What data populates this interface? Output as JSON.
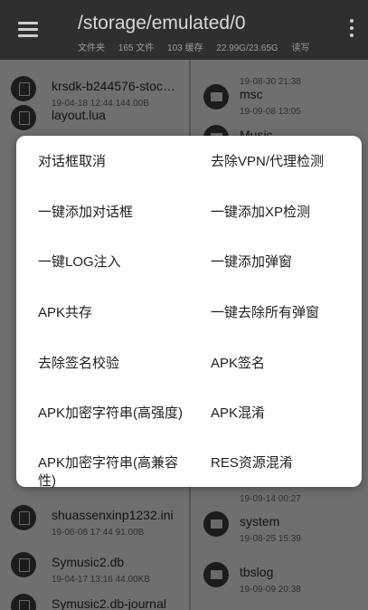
{
  "toolbar": {
    "path": "/storage/emulated/0",
    "folders": "文件夹",
    "files_count": "165 文件",
    "cache": "103 缓存",
    "storage": "22.99G/23.65G",
    "access": "读写"
  },
  "left_pane": {
    "rows": [
      {
        "name": "krsdk-b244576-stoc…",
        "meta": "19-04-18 12:44  144.00B"
      },
      {
        "name": "layout.lua",
        "meta": ""
      },
      {
        "name": "shuassenxinp1232.ini",
        "meta": "19-06-08 17:44  91.00B"
      },
      {
        "name": "Symusic2.db",
        "meta": "19-04-17 13:16  44.00KB"
      },
      {
        "name": "Symusic2.db-journal",
        "meta": ""
      }
    ]
  },
  "right_pane": {
    "rows": [
      {
        "name": "",
        "meta": "19-08-30 21:38"
      },
      {
        "name": "msc",
        "meta": "19-09-08 13:05"
      },
      {
        "name": "Music",
        "meta": ""
      },
      {
        "name": "",
        "meta": "19-09-14 00:27"
      },
      {
        "name": "system",
        "meta": "19-08-25 15:39"
      },
      {
        "name": "tbslog",
        "meta": "19-09-09 20:38"
      }
    ]
  },
  "dialog": {
    "options": [
      [
        "对话框取消",
        "去除VPN/代理检测"
      ],
      [
        "一键添加对话框",
        "一键添加XP检测"
      ],
      [
        "一键LOG注入",
        "一键添加弹窗"
      ],
      [
        "APK共存",
        "一键去除所有弹窗"
      ],
      [
        "去除签名校验",
        "APK签名"
      ],
      [
        "APK加密字符串(高强度)",
        "APK混淆"
      ],
      [
        "APK加密字符串(高兼容性)",
        "RES资源混淆"
      ]
    ]
  },
  "colors": {
    "toolbar_bg": "#2f2f2f",
    "dim_overlay": "#6f6f6f",
    "dialog_bg": "#ffffff"
  }
}
